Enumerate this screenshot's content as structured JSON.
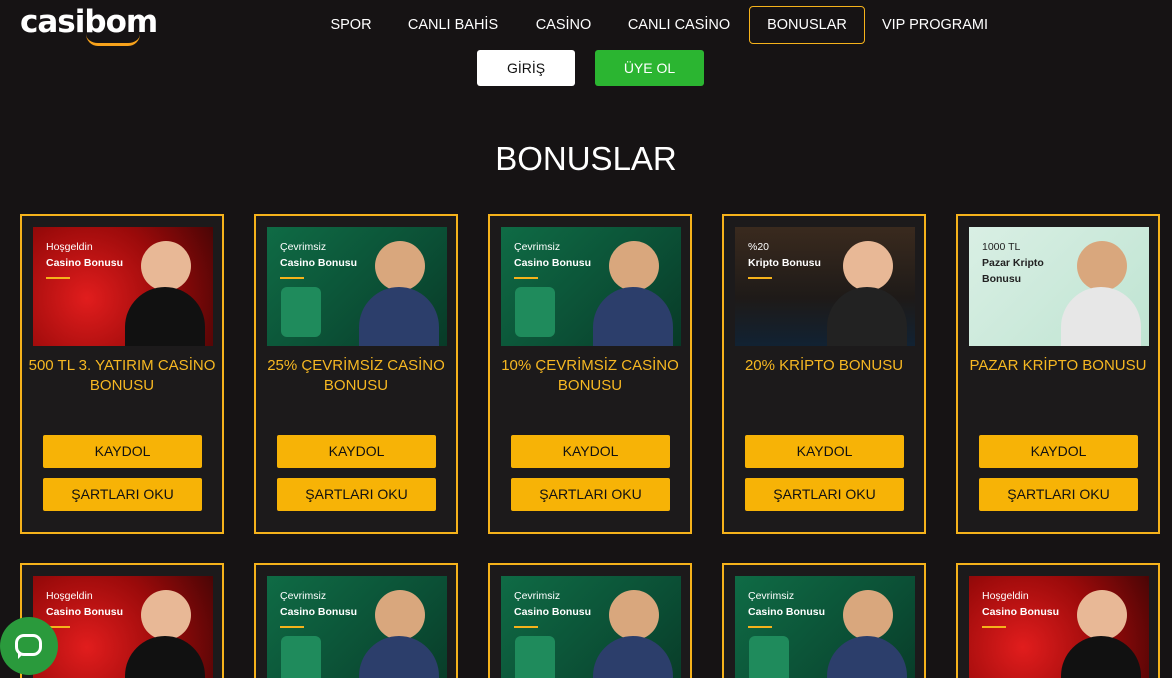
{
  "brand": {
    "logo_text": "casibom",
    "accent_color": "#f5b21b"
  },
  "nav": {
    "items": [
      {
        "label": "SPOR",
        "name": "nav-spor"
      },
      {
        "label": "CANLI BAHİS",
        "name": "nav-canli-bahis"
      },
      {
        "label": "CASİNO",
        "name": "nav-casino"
      },
      {
        "label": "CANLI CASİNO",
        "name": "nav-canli-casino"
      },
      {
        "label": "BONUSLAR",
        "name": "nav-bonuslar",
        "active": true
      },
      {
        "label": "VIP PROGRAMI",
        "name": "nav-vip-programi"
      }
    ]
  },
  "auth": {
    "login_label": "GİRİŞ",
    "register_label": "ÜYE OL",
    "register_color": "#2bb531"
  },
  "page": {
    "title": "BONUSLAR"
  },
  "cards_row1": [
    {
      "img_line1": "Hoşgeldin",
      "img_line2": "Casino Bonusu",
      "theme": "red",
      "title": "500 TL 3. YATIRIM CASİNO BONUSU",
      "kaydol": "KAYDOL",
      "sartlar": "ŞARTLARI OKU"
    },
    {
      "img_line1": "Çevrimsiz",
      "img_line2": "Casino Bonusu",
      "theme": "green",
      "title": "25% ÇEVRİMSİZ CASİNO BONUSU",
      "kaydol": "KAYDOL",
      "sartlar": "ŞARTLARI OKU"
    },
    {
      "img_line1": "Çevrimsiz",
      "img_line2": "Casino Bonusu",
      "theme": "green",
      "title": "10% ÇEVRİMSİZ CASİNO BONUSU",
      "kaydol": "KAYDOL",
      "sartlar": "ŞARTLARI OKU"
    },
    {
      "img_line1": "%20",
      "img_line2": "Kripto Bonusu",
      "theme": "dark",
      "title": "20% KRİPTO BONUSU",
      "kaydol": "KAYDOL",
      "sartlar": "ŞARTLARI OKU"
    },
    {
      "img_line1": "1000 TL",
      "img_line2": "Pazar Kripto",
      "img_line3": "Bonusu",
      "theme": "mint",
      "title": "PAZAR KRİPTO BONUSU",
      "kaydol": "KAYDOL",
      "sartlar": "ŞARTLARI OKU"
    }
  ],
  "cards_row2": [
    {
      "img_line1": "Hoşgeldin",
      "img_line2": "Casino Bonusu",
      "theme": "red"
    },
    {
      "img_line1": "Çevrimsiz",
      "img_line2": "Casino Bonusu",
      "theme": "green"
    },
    {
      "img_line1": "Çevrimsiz",
      "img_line2": "Casino Bonusu",
      "theme": "green"
    },
    {
      "img_line1": "Çevrimsiz",
      "img_line2": "Casino Bonusu",
      "theme": "green"
    },
    {
      "img_line1": "Hoşgeldin",
      "img_line2": "Casino Bonusu",
      "theme": "red"
    }
  ],
  "chat": {
    "icon": "chat-bubble-icon"
  }
}
